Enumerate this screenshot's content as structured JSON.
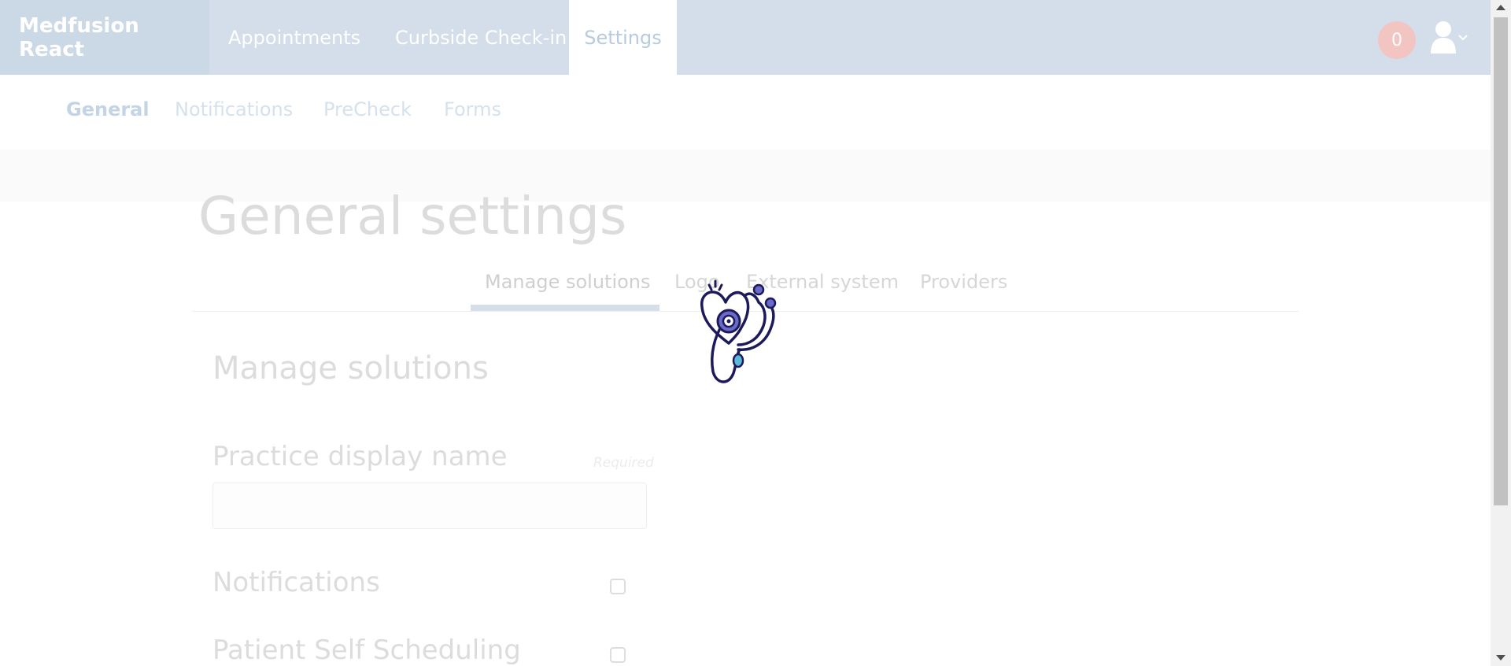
{
  "topnav": {
    "brand": "Medfusion React",
    "links": [
      {
        "label": "Appointments"
      },
      {
        "label": "Curbside Check-in"
      },
      {
        "label": "Settings",
        "active": true
      }
    ],
    "notification_count": "0",
    "user_icon": "user-icon",
    "dropdown_icon": "chevron-down-icon"
  },
  "subnav": {
    "items": [
      {
        "label": "General",
        "active": true
      },
      {
        "label": "Notifications"
      },
      {
        "label": "PreCheck"
      },
      {
        "label": "Forms"
      }
    ]
  },
  "main": {
    "title": "General settings",
    "tabs": [
      {
        "label": "Manage solutions",
        "active": true
      },
      {
        "label": "Logo"
      },
      {
        "label": "External system"
      },
      {
        "label": "Providers"
      }
    ],
    "section_title": "Manage solutions",
    "fields": {
      "practice_display_name": {
        "label": "Practice display name",
        "required_note": "Required",
        "value": ""
      },
      "notifications": {
        "label": "Notifications",
        "checked": false
      },
      "patient_self_scheduling": {
        "label": "Patient Self Scheduling",
        "checked": false
      }
    }
  },
  "loader": {
    "icon": "stethoscope-heart-icon"
  },
  "colors": {
    "nav_bg": "#d3deea",
    "brand_bg": "#cbd8e6",
    "badge": "#f3c5c2",
    "loader_stroke": "#1c1a5b",
    "loader_accent": "#6a6ac8",
    "loader_teal": "#5ab8d8"
  }
}
